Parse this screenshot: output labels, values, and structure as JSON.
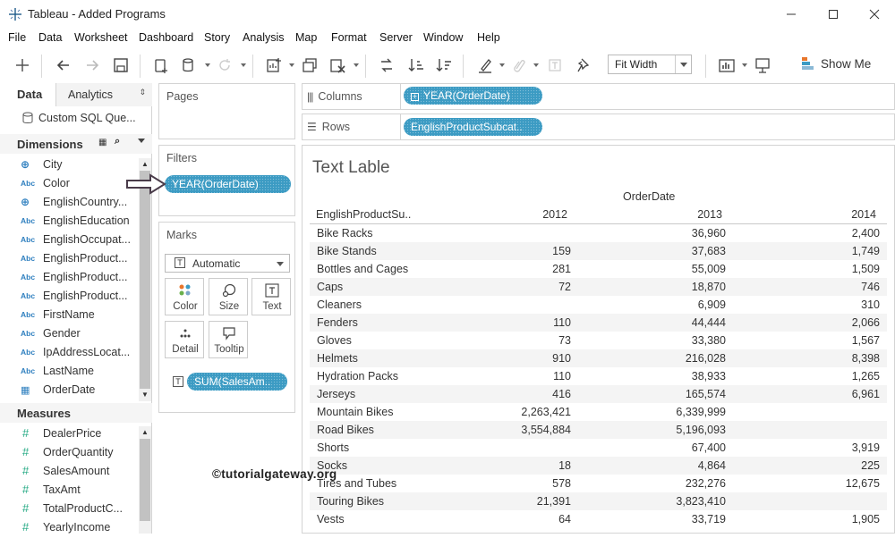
{
  "window": {
    "title": "Tableau - Added Programs"
  },
  "menu": [
    "File",
    "Data",
    "Worksheet",
    "Dashboard",
    "Story",
    "Analysis",
    "Map",
    "Format",
    "Server",
    "Window",
    "Help"
  ],
  "toolbar": {
    "fit": "Fit Width",
    "show_me": "Show Me"
  },
  "left": {
    "tab_data": "Data",
    "tab_analytics": "Analytics",
    "datasource": "Custom SQL Que...",
    "dimensions_label": "Dimensions",
    "dimensions": [
      {
        "icon": "globe",
        "name": "City"
      },
      {
        "icon": "Abc",
        "name": "Color"
      },
      {
        "icon": "globe",
        "name": "EnglishCountry..."
      },
      {
        "icon": "Abc",
        "name": "EnglishEducation"
      },
      {
        "icon": "Abc",
        "name": "EnglishOccupat..."
      },
      {
        "icon": "Abc",
        "name": "EnglishProduct..."
      },
      {
        "icon": "Abc",
        "name": "EnglishProduct..."
      },
      {
        "icon": "Abc",
        "name": "EnglishProduct..."
      },
      {
        "icon": "Abc",
        "name": "FirstName"
      },
      {
        "icon": "Abc",
        "name": "Gender"
      },
      {
        "icon": "Abc",
        "name": "IpAddressLocat..."
      },
      {
        "icon": "Abc",
        "name": "LastName"
      },
      {
        "icon": "date",
        "name": "OrderDate"
      }
    ],
    "measures_label": "Measures",
    "measures": [
      "DealerPrice",
      "OrderQuantity",
      "SalesAmount",
      "TaxAmt",
      "TotalProductC...",
      "YearlyIncome"
    ]
  },
  "shelves": {
    "pages": "Pages",
    "filters": "Filters",
    "filter_pill": "YEAR(OrderDate)",
    "marks": "Marks",
    "mark_type": "Automatic",
    "mark_buttons": [
      "Color",
      "Size",
      "Text",
      "Detail",
      "Tooltip"
    ],
    "mark_pill": "SUM(SalesAm..",
    "columns": "Columns",
    "columns_pill": "YEAR(OrderDate)",
    "rows": "Rows",
    "rows_pill": "EnglishProductSubcat.."
  },
  "viz": {
    "title": "Text Lable",
    "column_group": "OrderDate",
    "row_header": "EnglishProductSu..",
    "years": [
      "2012",
      "2013",
      "2014"
    ],
    "rows": [
      {
        "name": "Bike Racks",
        "v": [
          "",
          "36,960",
          "2,400"
        ]
      },
      {
        "name": "Bike Stands",
        "v": [
          "159",
          "37,683",
          "1,749"
        ]
      },
      {
        "name": "Bottles and Cages",
        "v": [
          "281",
          "55,009",
          "1,509"
        ]
      },
      {
        "name": "Caps",
        "v": [
          "72",
          "18,870",
          "746"
        ]
      },
      {
        "name": "Cleaners",
        "v": [
          "",
          "6,909",
          "310"
        ]
      },
      {
        "name": "Fenders",
        "v": [
          "110",
          "44,444",
          "2,066"
        ]
      },
      {
        "name": "Gloves",
        "v": [
          "73",
          "33,380",
          "1,567"
        ]
      },
      {
        "name": "Helmets",
        "v": [
          "910",
          "216,028",
          "8,398"
        ]
      },
      {
        "name": "Hydration Packs",
        "v": [
          "110",
          "38,933",
          "1,265"
        ]
      },
      {
        "name": "Jerseys",
        "v": [
          "416",
          "165,574",
          "6,961"
        ]
      },
      {
        "name": "Mountain Bikes",
        "v": [
          "2,263,421",
          "6,339,999",
          ""
        ]
      },
      {
        "name": "Road Bikes",
        "v": [
          "3,554,884",
          "5,196,093",
          ""
        ]
      },
      {
        "name": "Shorts",
        "v": [
          "",
          "67,400",
          "3,919"
        ]
      },
      {
        "name": "Socks",
        "v": [
          "18",
          "4,864",
          "225"
        ]
      },
      {
        "name": "Tires and Tubes",
        "v": [
          "578",
          "232,276",
          "12,675"
        ]
      },
      {
        "name": "Touring Bikes",
        "v": [
          "21,391",
          "3,823,410",
          ""
        ]
      },
      {
        "name": "Vests",
        "v": [
          "64",
          "33,719",
          "1,905"
        ]
      }
    ]
  },
  "watermark": "©tutorialgateway.org"
}
